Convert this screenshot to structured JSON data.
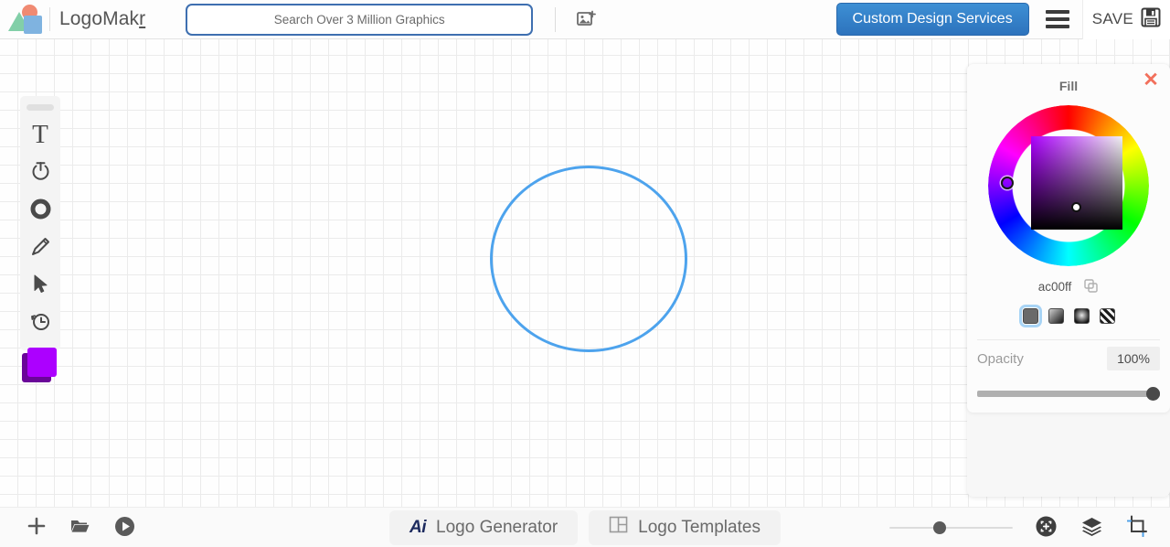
{
  "header": {
    "brand_name_main": "LogoMak",
    "brand_name_accent": "r",
    "logo_icon": "logomakr-shapes-icon",
    "search": {
      "placeholder": "Search Over 3 Million Graphics",
      "value": ""
    },
    "add_image_icon": "add-image-icon",
    "custom_design_label": "Custom Design Services",
    "menu_icon": "hamburger-menu-icon",
    "save_label": "SAVE",
    "save_icon": "floppy-disk-save-icon",
    "accent_blue": "#2d73bd"
  },
  "toolbar": {
    "drag_handle": "toolbar-drag-handle",
    "tools": [
      {
        "name": "text-tool",
        "icon": "text-T-icon",
        "label": "Text"
      },
      {
        "name": "curved-text-tool",
        "icon": "power-circle-icon",
        "label": "Curved Text"
      },
      {
        "name": "shapes-tool",
        "icon": "circle-donut-icon",
        "label": "Shapes"
      },
      {
        "name": "draw-tool",
        "icon": "pencil-icon",
        "label": "Draw"
      },
      {
        "name": "select-tool",
        "icon": "cursor-arrow-icon",
        "label": "Select"
      },
      {
        "name": "history-tool",
        "icon": "clock-history-icon",
        "label": "History"
      }
    ],
    "color_swatch": {
      "fill_color": "#ac00ff",
      "stroke_color": "#6a0699",
      "icon": "color-swatch-icon"
    }
  },
  "canvas": {
    "shape": {
      "type": "circle",
      "stroke_color": "#4da3ed",
      "fill": "none"
    },
    "grid_color": "#ebebeb"
  },
  "fill_panel": {
    "title": "Fill",
    "close_icon": "close-x-icon",
    "color_wheel_icon": "hue-ring-icon",
    "hex_value": "ac00ff",
    "copy_icon": "copy-icon",
    "selected_color": "#ac00ff",
    "fill_types": [
      {
        "name": "fill-type-solid",
        "icon": "solid-fill-icon",
        "selected": true
      },
      {
        "name": "fill-type-linear-gradient",
        "icon": "linear-gradient-icon",
        "selected": false
      },
      {
        "name": "fill-type-radial-gradient",
        "icon": "radial-gradient-icon",
        "selected": false
      },
      {
        "name": "fill-type-none",
        "icon": "no-fill-stripes-icon",
        "selected": false
      }
    ],
    "opacity_label": "Opacity",
    "opacity_value": "100%"
  },
  "bottombar": {
    "left_buttons": [
      {
        "name": "add-button",
        "icon": "plus-icon"
      },
      {
        "name": "open-file-button",
        "icon": "folder-open-icon"
      },
      {
        "name": "play-button",
        "icon": "play-circle-icon"
      }
    ],
    "tabs": [
      {
        "name": "tab-logo-generator",
        "icon": "ai-icon",
        "label": "Logo Generator",
        "icon_text": "Ai"
      },
      {
        "name": "tab-logo-templates",
        "icon": "grid-layout-icon",
        "label": "Logo Templates"
      }
    ],
    "zoom_slider": {
      "name": "zoom-slider",
      "position_percent": 36
    },
    "right_buttons": [
      {
        "name": "fit-to-screen-button",
        "icon": "fit-screen-crosshair-icon"
      },
      {
        "name": "layers-button",
        "icon": "layers-stack-icon"
      },
      {
        "name": "crop-button",
        "icon": "crop-icon"
      }
    ]
  }
}
